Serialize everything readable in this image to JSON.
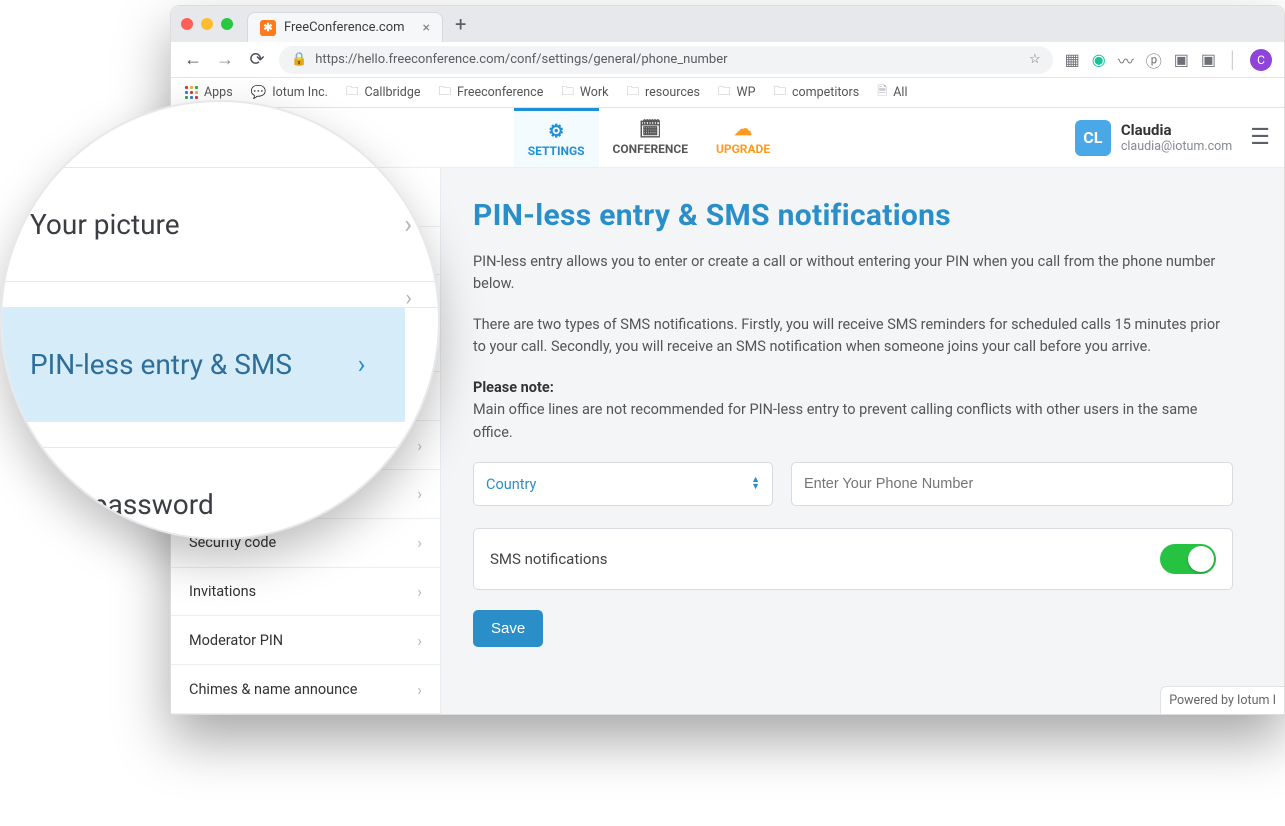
{
  "browser": {
    "tab_title": "FreeConference.com",
    "url": "https://hello.freeconference.com/conf/settings/general/phone_number",
    "bookmarks": {
      "apps": "Apps",
      "iotum": "Iotum Inc.",
      "callbridge": "Callbridge",
      "freeconference": "Freeconference",
      "work": "Work",
      "resources": "resources",
      "wp": "WP",
      "competitors": "competitors",
      "all": "All"
    }
  },
  "header": {
    "tabs": {
      "settings": "SETTINGS",
      "conference": "CONFERENCE",
      "upgrade": "UPGRADE"
    },
    "user": {
      "initials": "CL",
      "name": "Claudia",
      "email": "claudia@iotum.com"
    }
  },
  "sidebar": {
    "security_code": "Security code",
    "invitations": "Invitations",
    "moderator_pin": "Moderator PIN",
    "chimes": "Chimes & name announce"
  },
  "magnifier": {
    "row1": "Your picture",
    "row2": "PIN-less entry & SMS",
    "row3": "ur password"
  },
  "content": {
    "title": "PIN-less entry & SMS notifications",
    "p1": "PIN-less entry allows you to enter or create a call or without entering your PIN when you call from the phone number below.",
    "p2": "There are two types of SMS notifications. Firstly, you will receive SMS reminders for scheduled calls 15 minutes prior to your call. Secondly, you will receive an SMS notification when someone joins your call before you arrive.",
    "note_label": "Please note:",
    "note_body": "Main office lines are not recommended for PIN-less entry to prevent calling conflicts with other users in the same office.",
    "country_label": "Country",
    "phone_placeholder": "Enter Your Phone Number",
    "sms_label": "SMS notifications",
    "save": "Save",
    "powered": "Powered by Iotum I"
  },
  "avatar_letter": "C"
}
